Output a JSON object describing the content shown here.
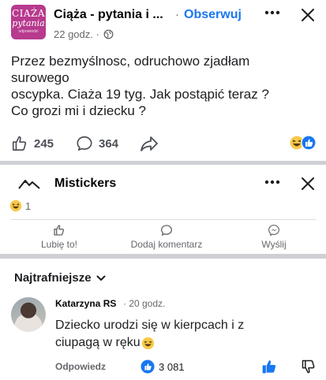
{
  "post": {
    "group_name": "Ciąża - pytania i ...",
    "separator": "·",
    "follow_label": "Obserwuj",
    "time": "22 godz. ·",
    "avatar_line1": "CIAŻA",
    "avatar_line2": "pytania",
    "avatar_line3": "odpowiedzi",
    "body_lines": [
      "Przez bezmyślnosc, odruchowo zjadłam",
      "surowego",
      "oscypka. Ciaża 19 tyg. Jak postąpić teraz ?",
      "Co grozi mi i dziecku ?"
    ],
    "like_count": "245",
    "comment_count": "364",
    "icons": [
      "globe-icon",
      "more-icon",
      "close-icon",
      "like-icon",
      "comment-icon",
      "share-icon",
      "haha-reaction-icon",
      "like-reaction-icon"
    ]
  },
  "mistickers": {
    "name": "Mistickers",
    "reaction_count": "1",
    "actions": {
      "like": "Lubię to!",
      "comment": "Dodaj komentarz",
      "send": "Wyślij"
    }
  },
  "comments": {
    "sort_label": "Najtrafniejsze",
    "items": [
      {
        "author": "Katarzyna RS",
        "time": "· 20 godz.",
        "text_lines": [
          "Dziecko urodzi się w kierpcach i z",
          "ciupagą w ręku"
        ],
        "reply_label": "Odpowiedz",
        "likes": "3 081"
      }
    ]
  },
  "colors": {
    "accent": "#1877f2",
    "group_avatar": "#b73a8e",
    "divider": "#ced0d4",
    "muted_text": "#65676b",
    "haha_yellow": "#f7c948"
  }
}
